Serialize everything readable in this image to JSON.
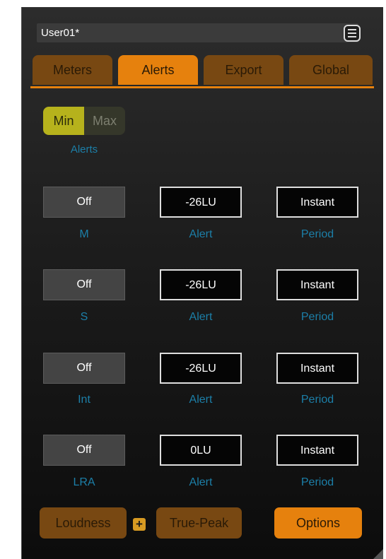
{
  "preset": {
    "name": "User01*",
    "menu_icon": "menu-icon"
  },
  "tabs": [
    {
      "label": "Meters",
      "active": false
    },
    {
      "label": "Alerts",
      "active": true
    },
    {
      "label": "Export",
      "active": false
    },
    {
      "label": "Global",
      "active": false
    }
  ],
  "minmax": {
    "min_label": "Min",
    "max_label": "Max",
    "selected": "Min",
    "caption": "Alerts"
  },
  "rows": [
    {
      "toggle": "Off",
      "toggle_caption": "M",
      "alert": "-26LU",
      "alert_caption": "Alert",
      "period": "Instant",
      "period_caption": "Period"
    },
    {
      "toggle": "Off",
      "toggle_caption": "S",
      "alert": "-26LU",
      "alert_caption": "Alert",
      "period": "Instant",
      "period_caption": "Period"
    },
    {
      "toggle": "Off",
      "toggle_caption": "Int",
      "alert": "-26LU",
      "alert_caption": "Alert",
      "period": "Instant",
      "period_caption": "Period"
    },
    {
      "toggle": "Off",
      "toggle_caption": "LRA",
      "alert": "0LU",
      "alert_caption": "Alert",
      "period": "Instant",
      "period_caption": "Period"
    }
  ],
  "bottom": {
    "loudness_label": "Loudness",
    "plus_symbol": "+",
    "truepeak_label": "True-Peak",
    "options_label": "Options"
  },
  "colors": {
    "accent": "#e6810d",
    "accent_dim": "#784812",
    "min_active": "#b6b21c",
    "caption": "#1c7fa8",
    "background": "#1c1c1c"
  }
}
